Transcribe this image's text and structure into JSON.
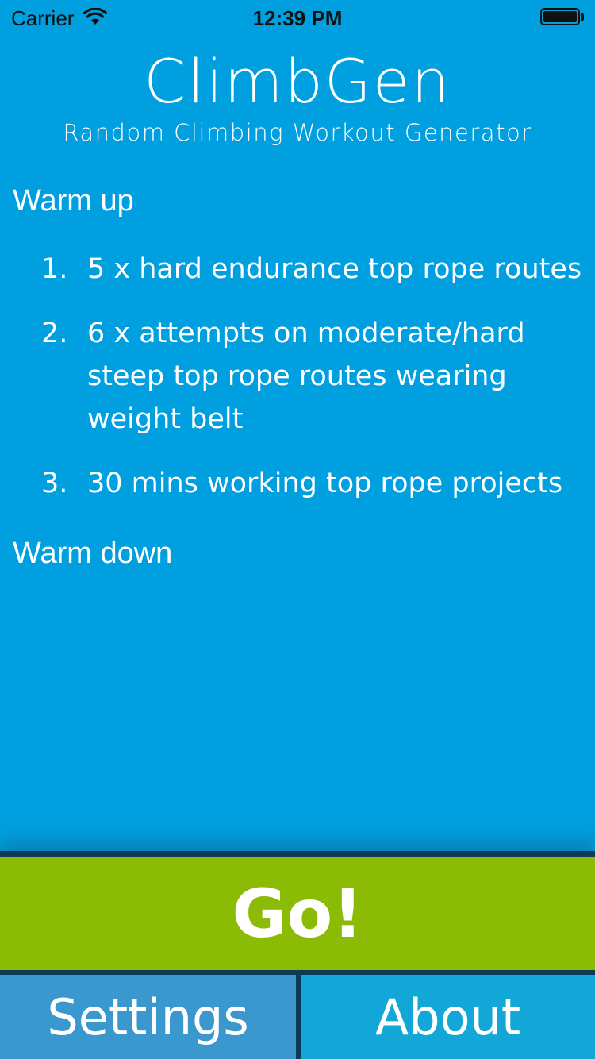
{
  "status_bar": {
    "carrier": "Carrier",
    "time": "12:39 PM",
    "battery_level": 1.0
  },
  "header": {
    "title": "ClimbGen",
    "subtitle": "Random Climbing Workout Generator"
  },
  "workout": {
    "warm_up_label": "Warm up",
    "steps": [
      {
        "number": "1.",
        "text": "5 x hard endurance top rope routes"
      },
      {
        "number": "2.",
        "text": "6 x attempts on moderate/hard steep top rope routes wearing weight belt"
      },
      {
        "number": "3.",
        "text": "30 mins working top rope projects"
      }
    ],
    "warm_down_label": "Warm down"
  },
  "actions": {
    "go_label": "Go!",
    "settings_label": "Settings",
    "about_label": "About"
  },
  "colors": {
    "background": "#009fe0",
    "go_button": "#8cbb06",
    "settings_button": "#3a98cf",
    "about_button": "#12a7d6",
    "divider": "#0d3b57"
  }
}
